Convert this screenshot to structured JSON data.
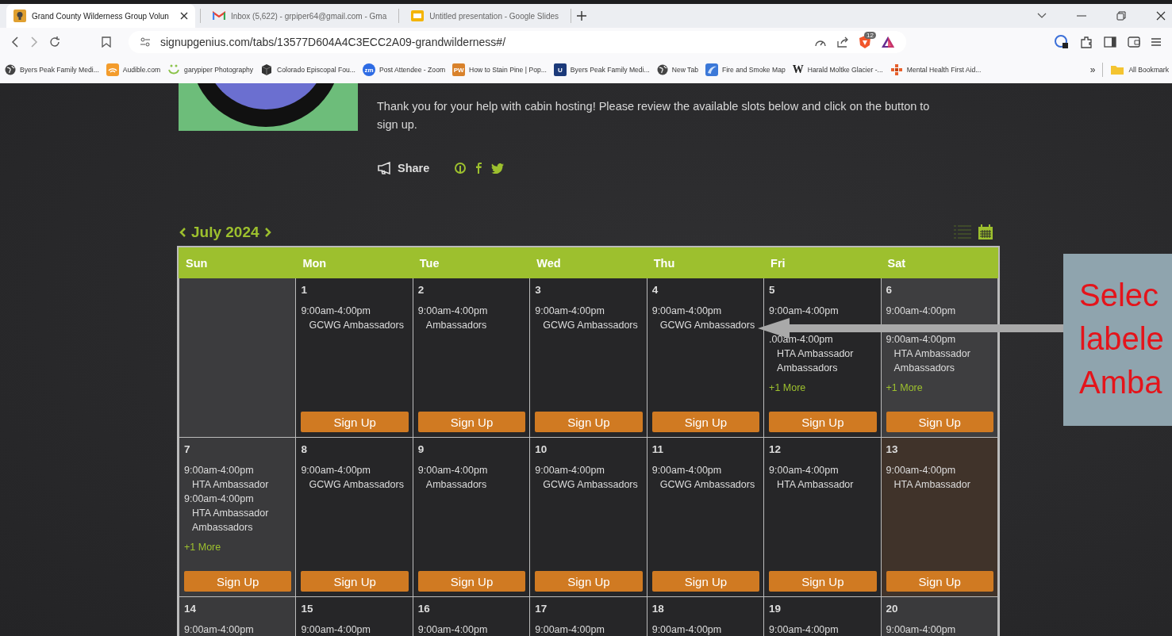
{
  "browser": {
    "tabs": [
      {
        "title": "Grand County Wilderness Group Volun",
        "selected": true
      },
      {
        "title": "Inbox (5,622) - grpiper64@gmail.com - Gma",
        "selected": false
      },
      {
        "title": "Untitled presentation - Google Slides",
        "selected": false
      }
    ],
    "address": "signupgenius.com/tabs/13577D604A4C3ECC2A09-grandwilderness#/",
    "shield_badge": "12",
    "bookmarks": [
      {
        "label": "Byers Peak Family Medi..."
      },
      {
        "label": "Audible.com"
      },
      {
        "label": "garypiper Photography"
      },
      {
        "label": "Colorado Episcopal Fou..."
      },
      {
        "label": "Post Attendee - Zoom",
        "icon_text": "zm"
      },
      {
        "label": "How to Stain Pine | Pop...",
        "icon_text": "PW"
      },
      {
        "label": "Byers Peak Family Medi...",
        "icon_text": "U"
      },
      {
        "label": "New Tab"
      },
      {
        "label": "Fire and Smoke Map"
      },
      {
        "label": "Harald Moltke Glacier -...",
        "icon_text": "W"
      },
      {
        "label": "Mental Health First Aid..."
      }
    ],
    "overflow": "»",
    "all_bookmarks": "All Bookmark"
  },
  "page": {
    "intro": "Thank you for your help with cabin hosting! Please review the available slots below and click on the button to sign up.",
    "share": "Share"
  },
  "calendar": {
    "month": "July 2024",
    "weekdays": [
      "Sun",
      "Mon",
      "Tue",
      "Wed",
      "Thu",
      "Fri",
      "Sat"
    ],
    "weeks": [
      [
        {
          "color": "#3c3c3e"
        },
        {
          "day": "1",
          "color": "#262628",
          "slots": [
            {
              "time": "9:00am-4:00pm",
              "role": "GCWG Ambassadors"
            }
          ],
          "button": "Sign Up"
        },
        {
          "day": "2",
          "color": "#262628",
          "slots": [
            {
              "time": "9:00am-4:00pm",
              "role": "Ambassadors"
            }
          ],
          "button": "Sign Up"
        },
        {
          "day": "3",
          "color": "#262628",
          "slots": [
            {
              "time": "9:00am-4:00pm",
              "role": "GCWG Ambassadors"
            }
          ],
          "button": "Sign Up"
        },
        {
          "day": "4",
          "color": "#262628",
          "slots": [
            {
              "time": "9:00am-4:00pm",
              "role": "GCWG Ambassadors"
            }
          ],
          "button": "Sign Up"
        },
        {
          "day": "5",
          "color": "#262628",
          "slots": [
            {
              "time": "9:00am-4:00pm"
            },
            {
              "time": ".00am-4:00pm",
              "role": "HTA Ambassador Ambassadors"
            }
          ],
          "more": "+1 More",
          "button": "Sign Up"
        },
        {
          "day": "6",
          "color": "#3e3e40",
          "slots": [
            {
              "time": "9:00am-4:00pm"
            },
            {
              "time": "9:00am-4:00pm",
              "role": "HTA Ambassador Ambassadors"
            }
          ],
          "more": "+1 More",
          "button": "Sign Up"
        }
      ],
      [
        {
          "day": "7",
          "color": "#3a3a3c",
          "slots": [
            {
              "time": "9:00am-4:00pm",
              "role": "HTA Ambassador"
            },
            {
              "time": "9:00am-4:00pm",
              "role": "HTA Ambassador Ambassadors"
            }
          ],
          "more": "+1 More",
          "button": "Sign Up"
        },
        {
          "day": "8",
          "color": "#262628",
          "slots": [
            {
              "time": "9:00am-4:00pm",
              "role": "GCWG Ambassadors"
            }
          ],
          "button": "Sign Up"
        },
        {
          "day": "9",
          "color": "#262628",
          "slots": [
            {
              "time": "9:00am-4:00pm",
              "role": "Ambassadors"
            }
          ],
          "button": "Sign Up"
        },
        {
          "day": "10",
          "color": "#262628",
          "slots": [
            {
              "time": "9:00am-4:00pm",
              "role": "GCWG Ambassadors"
            }
          ],
          "button": "Sign Up"
        },
        {
          "day": "11",
          "color": "#262628",
          "slots": [
            {
              "time": "9:00am-4:00pm",
              "role": "GCWG Ambassadors"
            }
          ],
          "button": "Sign Up"
        },
        {
          "day": "12",
          "color": "#262628",
          "slots": [
            {
              "time": "9:00am-4:00pm",
              "role": "HTA Ambassador"
            }
          ],
          "button": "Sign Up"
        },
        {
          "day": "13",
          "color": "#40332a",
          "slots": [
            {
              "time": "9:00am-4:00pm",
              "role": "HTA Ambassador"
            }
          ],
          "button": "Sign Up"
        }
      ],
      [
        {
          "day": "14",
          "color": "#3a3a3c",
          "slots": [
            {
              "time": "9:00am-4:00pm"
            }
          ]
        },
        {
          "day": "15",
          "color": "#262628",
          "slots": [
            {
              "time": "9:00am-4:00pm"
            }
          ]
        },
        {
          "day": "16",
          "color": "#262628",
          "slots": [
            {
              "time": "9:00am-4:00pm"
            }
          ]
        },
        {
          "day": "17",
          "color": "#262628",
          "slots": [
            {
              "time": "9:00am-4:00pm"
            }
          ]
        },
        {
          "day": "18",
          "color": "#262628",
          "slots": [
            {
              "time": "9:00am-4:00pm"
            }
          ]
        },
        {
          "day": "19",
          "color": "#262628",
          "slots": [
            {
              "time": "9:00am-4:00pm"
            }
          ]
        },
        {
          "day": "20",
          "color": "#3a3a3c",
          "slots": [
            {
              "time": "9:00am-4:00pm"
            }
          ]
        }
      ]
    ]
  },
  "callout": {
    "lines": [
      "Selec",
      "labele",
      "Amba"
    ]
  }
}
